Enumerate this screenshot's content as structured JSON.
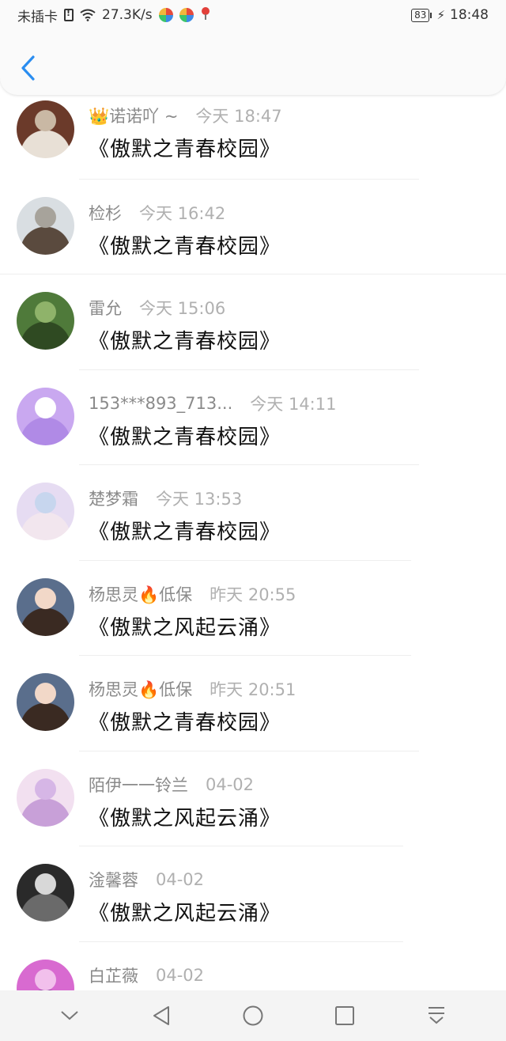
{
  "status_bar": {
    "sim": "未插卡",
    "speed": "27.3K/s",
    "battery": "83",
    "time": "18:48"
  },
  "header": {
    "back_icon": "chevron-left-icon"
  },
  "items": [
    {
      "name": "👑诺诺吖 ~",
      "time": "今天 18:47",
      "title": "《傲默之青春校园》",
      "avatar_colors": [
        "#6b3a2a",
        "#c9b8a4",
        "#e8e0d6"
      ]
    },
    {
      "name": "检杉",
      "time": "今天 16:42",
      "title": "《傲默之青春校园》",
      "avatar_colors": [
        "#d9dee2",
        "#a7a39b",
        "#5a4a3e"
      ]
    },
    {
      "name": "雷允",
      "time": "今天 15:06",
      "title": "《傲默之青春校园》",
      "avatar_colors": [
        "#4f7a3a",
        "#8fb36a",
        "#2f4a22"
      ]
    },
    {
      "name": "153***893_713...",
      "time": "今天 14:11",
      "title": "《傲默之青春校园》",
      "avatar_colors": [
        "#c9a8f0",
        "#ffffff",
        "#b08ae6"
      ]
    },
    {
      "name": "楚梦霜",
      "time": "今天 13:53",
      "title": "《傲默之青春校园》",
      "avatar_colors": [
        "#e6dcf2",
        "#c7d6ee",
        "#f2e6ee"
      ]
    },
    {
      "name": "杨思灵🔥低保",
      "time": "昨天 20:55",
      "title": "《傲默之风起云涌》",
      "avatar_colors": [
        "#5a6e8c",
        "#f2d8c8",
        "#3a2a22"
      ]
    },
    {
      "name": "杨思灵🔥低保",
      "time": "昨天 20:51",
      "title": "《傲默之青春校园》",
      "avatar_colors": [
        "#5a6e8c",
        "#f2d8c8",
        "#3a2a22"
      ]
    },
    {
      "name": "陌伊一一铃兰",
      "time": "04-02",
      "title": "《傲默之风起云涌》",
      "avatar_colors": [
        "#f2e0f0",
        "#d6b6e6",
        "#c8a0d8"
      ]
    },
    {
      "name": "淦馨蓉",
      "time": "04-02",
      "title": "《傲默之风起云涌》",
      "avatar_colors": [
        "#2a2a2a",
        "#d8d8d8",
        "#6a6a6a"
      ]
    },
    {
      "name": "白芷薇",
      "time": "04-02",
      "title": "",
      "avatar_colors": [
        "#d86ad0",
        "#f2c0ec",
        "#8a3a9a"
      ]
    }
  ],
  "nav_bar": {
    "icons": [
      "chevron-down-icon",
      "back-triangle-icon",
      "home-circle-icon",
      "recents-square-icon",
      "pull-down-icon"
    ]
  }
}
